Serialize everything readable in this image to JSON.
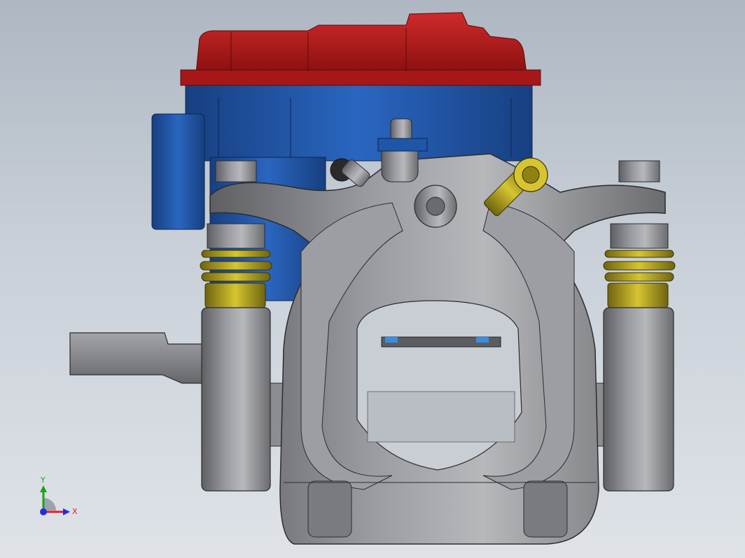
{
  "viewport": {
    "background_top": "#aeb7c2",
    "background_bottom": "#dfe3e8"
  },
  "model": {
    "parts": [
      {
        "name": "housing-cover",
        "color": "#b01a1a"
      },
      {
        "name": "motor-housing",
        "color": "#1f56a8"
      },
      {
        "name": "caliper-body",
        "color": "#8f9094"
      },
      {
        "name": "spring-washers",
        "color": "#c9b41a"
      },
      {
        "name": "bleed-bolt",
        "color": "#c9b41a"
      },
      {
        "name": "brake-pads",
        "color": "#3a8de0"
      }
    ]
  },
  "triad": {
    "x_label": "X",
    "y_label": "Y",
    "x_color": "#e02020",
    "y_color": "#20a020",
    "z_color": "#2030e0"
  }
}
